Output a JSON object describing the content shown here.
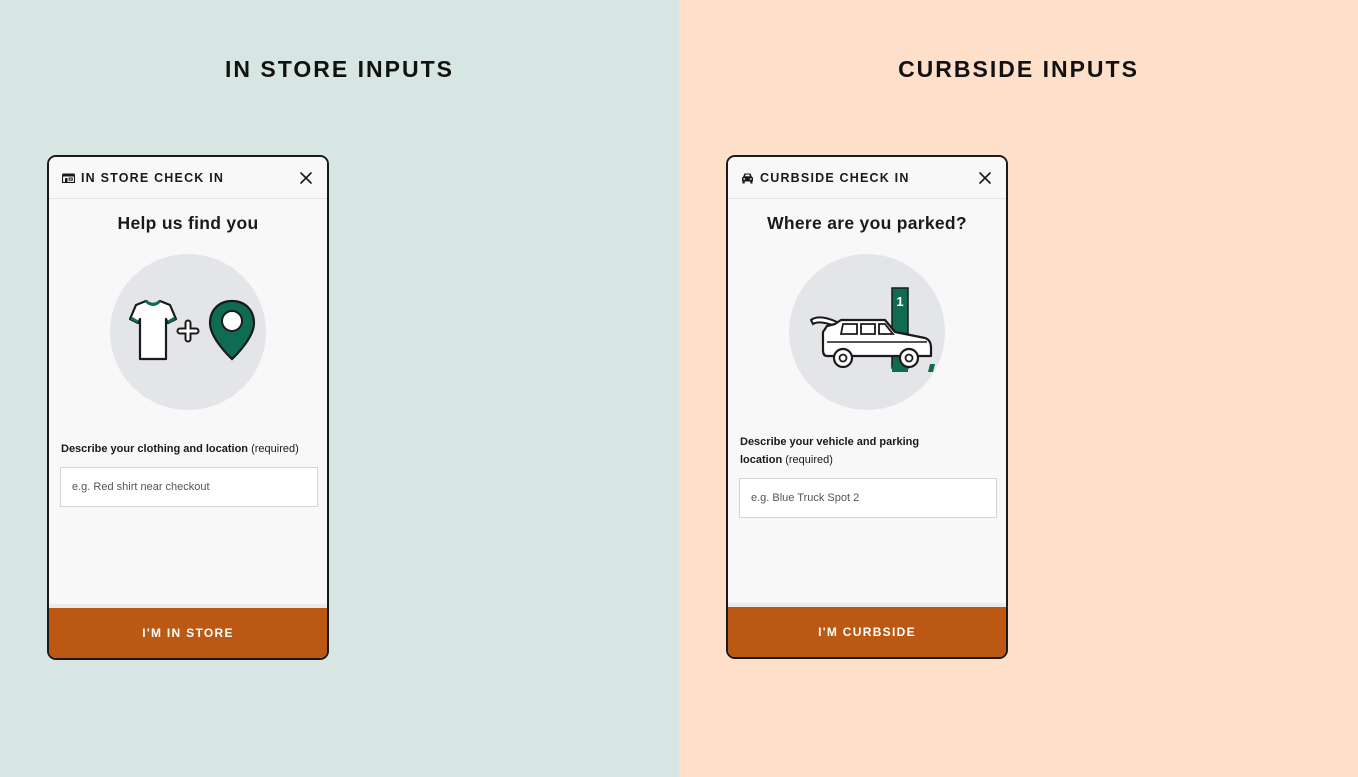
{
  "left_panel": {
    "heading": "IN STORE INPUTS",
    "background": "#d7e6e2",
    "modal": {
      "header_icon": "store-icon",
      "header_title": "IN STORE CHECK IN",
      "close_icon": "close-icon",
      "title": "Help us find you",
      "illustration": "shirt-plus-location-pin-illustration",
      "field_label_bold": "Describe your clothing and location",
      "field_label_suffix": "(required)",
      "input_placeholder": "e.g. Red shirt near checkout",
      "input_value": "",
      "button_label": "I'M IN STORE"
    }
  },
  "right_panel": {
    "heading": "CURBSIDE INPUTS",
    "background": "#fddfca",
    "modal": {
      "header_icon": "car-icon",
      "header_title": "CURBSIDE CHECK IN",
      "close_icon": "close-icon",
      "title": "Where are you parked?",
      "illustration": "car-parking-spot-illustration",
      "parking_spot_number": "1",
      "field_label_bold": "Describe your vehicle and parking location",
      "field_label_suffix": "(required)",
      "input_placeholder": "e.g. Blue Truck Spot 2",
      "input_value": "",
      "button_label": "I'M CURBSIDE"
    }
  },
  "colors": {
    "accent_button": "#bb5813",
    "brand_green": "#0f6b52",
    "illustration_circle": "#e3e5e9",
    "modal_border": "#1a1a1a"
  }
}
